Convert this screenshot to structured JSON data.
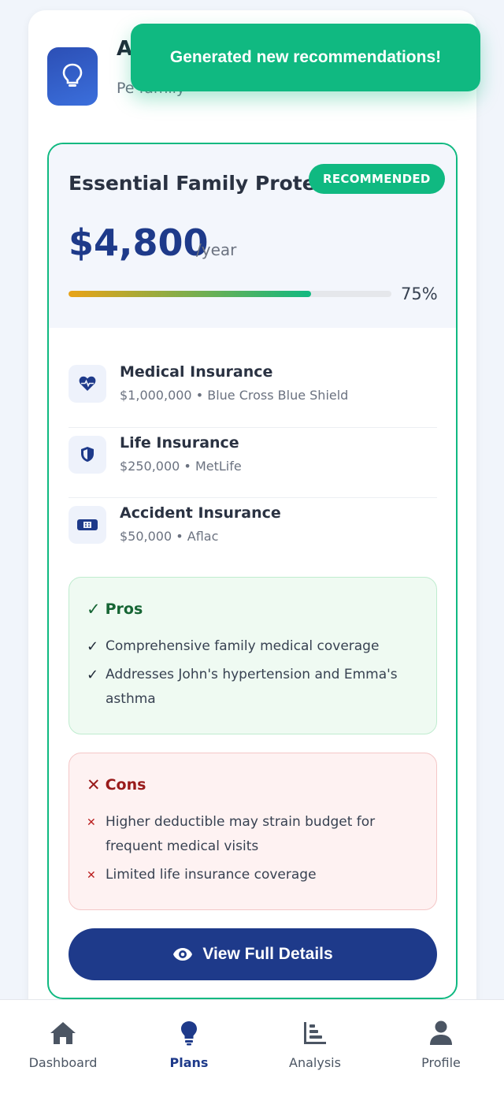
{
  "header": {
    "icon": "lightbulb-icon",
    "title": "A",
    "subtitle": "Pe family"
  },
  "toast": {
    "message": "Generated new recommendations!"
  },
  "plan": {
    "name": "Essential Family Protec",
    "badge": "RECOMMENDED",
    "price": "$4,800",
    "period": "/year",
    "match_percent": 75,
    "match_label": "75%",
    "coverages": [
      {
        "icon": "heart-pulse-icon",
        "title": "Medical Insurance",
        "meta": "$1,000,000 • Blue Cross Blue Shield"
      },
      {
        "icon": "shield-icon",
        "title": "Life Insurance",
        "meta": "$250,000 • MetLife"
      },
      {
        "icon": "bandage-icon",
        "title": "Accident Insurance",
        "meta": "$50,000 • Aflac"
      }
    ],
    "pros": {
      "title": "Pros",
      "items": [
        "Comprehensive family medical coverage",
        "Addresses John's hypertension and Emma's asthma"
      ]
    },
    "cons": {
      "title": "Cons",
      "items": [
        "Higher deductible may strain budget for frequent medical visits",
        "Limited life insurance coverage"
      ]
    },
    "details_button": "View Full Details"
  },
  "nav": {
    "items": [
      {
        "icon": "home-icon",
        "label": "Dashboard",
        "active": false
      },
      {
        "icon": "lightbulb-icon",
        "label": "Plans",
        "active": true
      },
      {
        "icon": "bar-chart-icon",
        "label": "Analysis",
        "active": false
      },
      {
        "icon": "user-icon",
        "label": "Profile",
        "active": false
      }
    ]
  },
  "colors": {
    "accent_green": "#10b981",
    "primary_blue": "#1e3a8a"
  }
}
